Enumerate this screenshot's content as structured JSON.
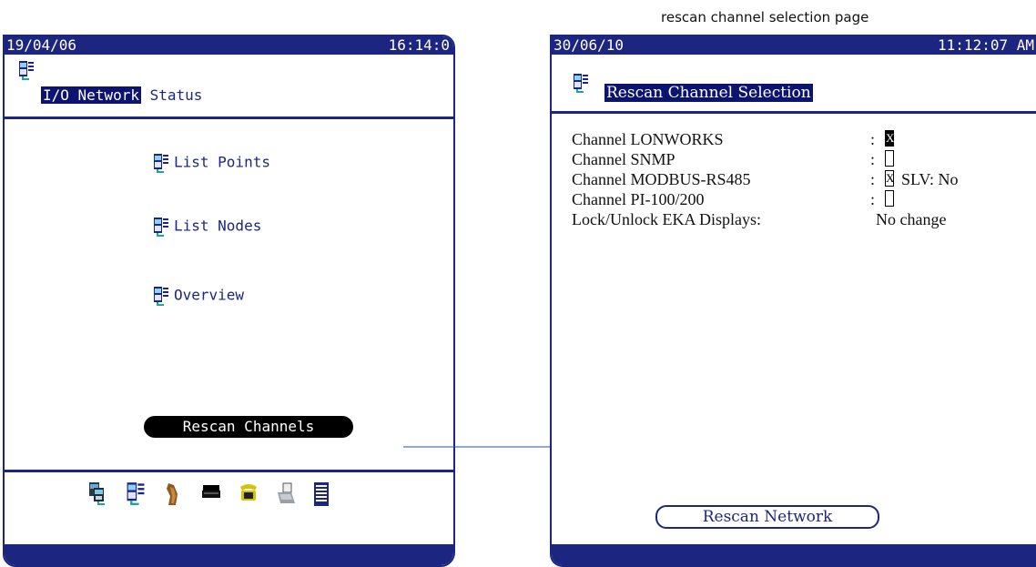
{
  "caption": "rescan channel selection page",
  "left_screen": {
    "date": "19/04/06",
    "time": "16:14:0",
    "title_highlight": "I/O Network",
    "title_rest": "Status",
    "menu": {
      "list_points": "List Points",
      "list_nodes": "List Nodes",
      "overview": "Overview"
    },
    "rescan_button": "Rescan Channels",
    "toolbar_icons": [
      "network-icon",
      "device-icon",
      "horn-icon",
      "printer-icon",
      "telephone-icon",
      "fax-icon",
      "log-icon"
    ]
  },
  "right_screen": {
    "date": "30/06/10",
    "time": "11:12:07 AM",
    "title": "Rescan Channel Selection",
    "rows": [
      {
        "label": "Channel LONWORKS",
        "checked": "X"
      },
      {
        "label": "Channel SNMP",
        "checked": ""
      },
      {
        "label": "Channel MODBUS-RS485",
        "checked": "X",
        "extra": "SLV: No"
      },
      {
        "label": "Channel PI-100/200",
        "checked": ""
      }
    ],
    "lock_label": "Lock/Unlock EKA Displays",
    "lock_value": "No change",
    "rescan_button": "Rescan Network"
  },
  "colors": {
    "navy": "#1c2680",
    "highlight": "#0c1470"
  }
}
